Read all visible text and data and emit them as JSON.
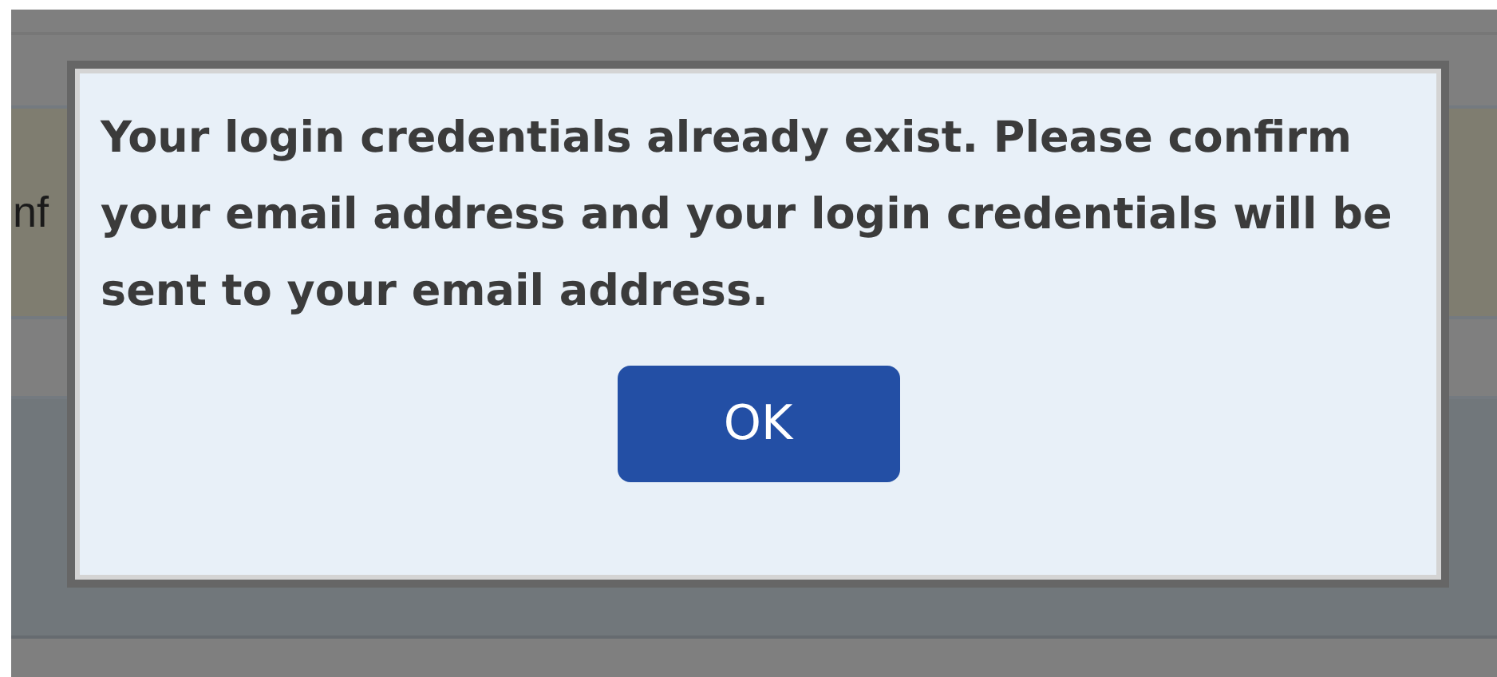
{
  "page": {
    "partial_label": "nf"
  },
  "dialog": {
    "message": "Your login credentials already exist. Please confirm your email address and your login credentials will be sent to your email address.",
    "button": "OK"
  }
}
